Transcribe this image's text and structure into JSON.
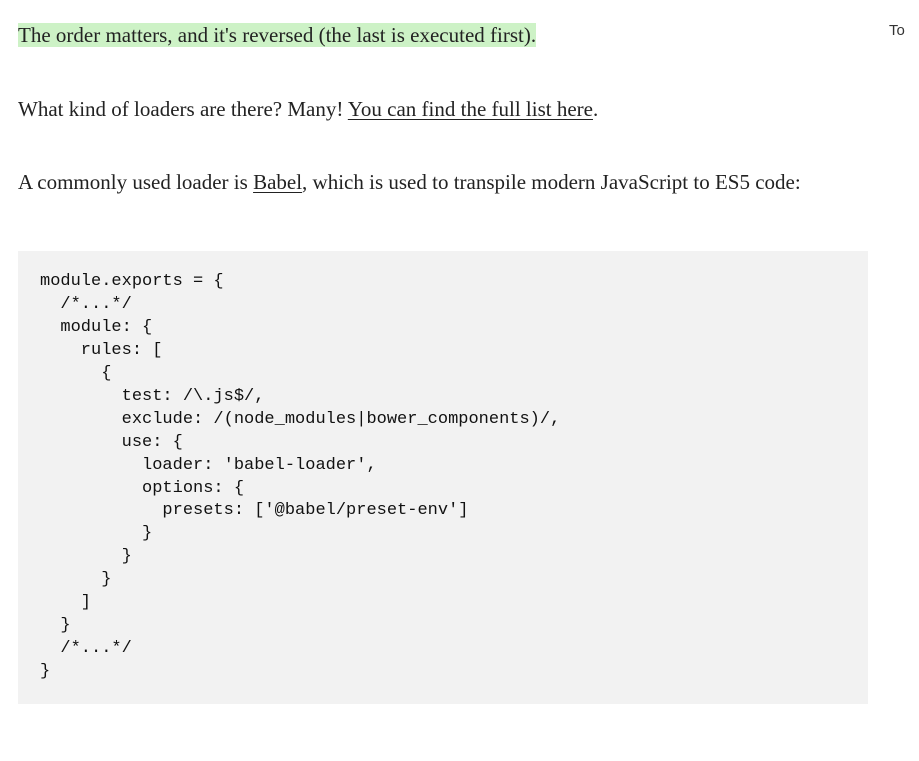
{
  "side_label": "To",
  "para1": {
    "mark": "The order matters, and it's reversed (the last is executed first)."
  },
  "para2": {
    "pre": "What kind of loaders are there? Many! ",
    "link": "You can find the full list here",
    "post": "."
  },
  "para3": {
    "pre": "A commonly used loader is ",
    "link": "Babel",
    "post": ", which is used to transpile modern JavaScript to ES5 code:"
  },
  "code": "module.exports = {\n  /*...*/\n  module: {\n    rules: [\n      {\n        test: /\\.js$/,\n        exclude: /(node_modules|bower_components)/,\n        use: {\n          loader: 'babel-loader',\n          options: {\n            presets: ['@babel/preset-env']\n          }\n        }\n      }\n    ]\n  }\n  /*...*/\n}"
}
